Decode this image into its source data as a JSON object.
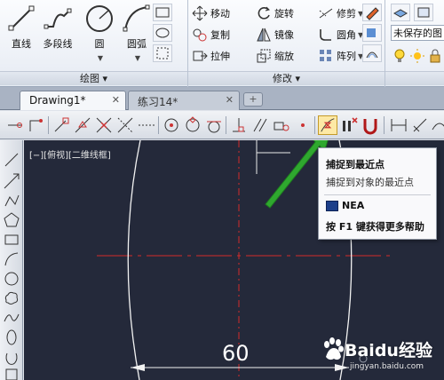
{
  "ribbon": {
    "draw_panel": {
      "title": "绘图",
      "buttons": [
        {
          "label": "直线",
          "icon": "line-icon"
        },
        {
          "label": "多段线",
          "icon": "polyline-icon"
        },
        {
          "label": "圆",
          "icon": "circle-icon"
        },
        {
          "label": "圆弧",
          "icon": "arc-icon"
        }
      ]
    },
    "modify_panel": {
      "title": "修改",
      "rows": [
        [
          {
            "label": "移动",
            "icon": "move-icon"
          },
          {
            "label": "旋转",
            "icon": "rotate-icon"
          },
          {
            "label": "修剪",
            "icon": "trim-icon"
          }
        ],
        [
          {
            "label": "复制",
            "icon": "copy-icon"
          },
          {
            "label": "镜像",
            "icon": "mirror-icon"
          },
          {
            "label": "圆角",
            "icon": "fillet-icon"
          }
        ],
        [
          {
            "label": "拉伸",
            "icon": "stretch-icon"
          },
          {
            "label": "缩放",
            "icon": "scale-icon"
          },
          {
            "label": "阵列",
            "icon": "array-icon"
          }
        ]
      ]
    },
    "layers_panel": {
      "layer_state": "未保存的图"
    }
  },
  "tabs": [
    {
      "label": "Drawing1*",
      "active": true
    },
    {
      "label": "练习14*",
      "active": false
    }
  ],
  "canvas": {
    "viewport_label": "[−][俯视][二维线框]",
    "dimension_value": "60"
  },
  "tooltip": {
    "title": "捕捉到最近点",
    "description": "捕捉到对象的最近点",
    "command": "NEA",
    "help": "按 F1 键获得更多帮助"
  },
  "watermark": {
    "brand": "Baidu经验",
    "url": "jingyan.baidu.com"
  },
  "colors": {
    "canvas_bg": "#24293a",
    "centerline": "#d42a2a",
    "arrow": "#2fa82f",
    "highlight": "#fde9a5"
  }
}
